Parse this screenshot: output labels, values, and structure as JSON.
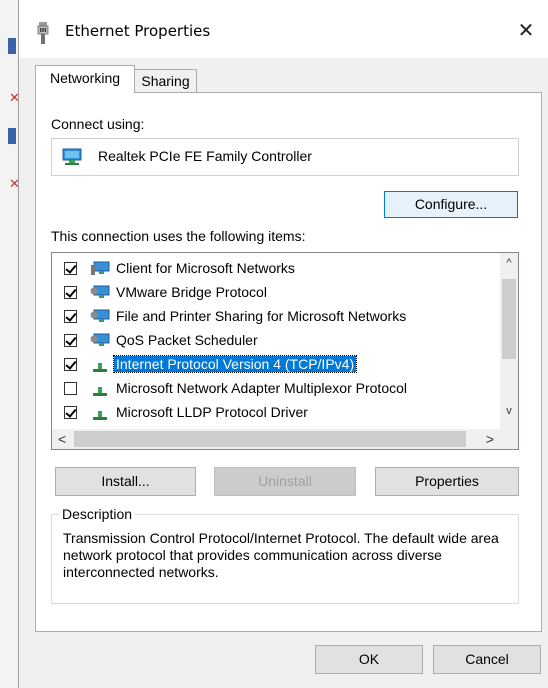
{
  "window": {
    "title": "Ethernet Properties",
    "close_glyph": "✕"
  },
  "tabs": [
    {
      "label": "Networking",
      "active": true
    },
    {
      "label": "Sharing",
      "active": false
    }
  ],
  "connect": {
    "label": "Connect using:",
    "adapter_name": "Realtek PCIe FE Family Controller",
    "adapter_icon": "network-adapter-icon",
    "configure_label": "Configure..."
  },
  "items_section": {
    "label": "This connection uses the following items:",
    "items": [
      {
        "label": "Client for Microsoft Networks",
        "checked": true,
        "icon": "network-client-icon",
        "selected": false
      },
      {
        "label": "VMware Bridge Protocol",
        "checked": true,
        "icon": "network-service-icon",
        "selected": false
      },
      {
        "label": "File and Printer Sharing for Microsoft Networks",
        "checked": true,
        "icon": "network-service-icon",
        "selected": false
      },
      {
        "label": "QoS Packet Scheduler",
        "checked": true,
        "icon": "network-service-icon",
        "selected": false
      },
      {
        "label": "Internet Protocol Version 4 (TCP/IPv4)",
        "checked": true,
        "icon": "protocol-icon",
        "selected": true
      },
      {
        "label": "Microsoft Network Adapter Multiplexor Protocol",
        "checked": false,
        "icon": "protocol-icon",
        "selected": false
      },
      {
        "label": "Microsoft LLDP Protocol Driver",
        "checked": true,
        "icon": "protocol-icon",
        "selected": false
      }
    ],
    "scroll_up": "^",
    "scroll_down": "v",
    "scroll_left": "<",
    "scroll_right": ">"
  },
  "buttons": {
    "install": "Install...",
    "uninstall": "Uninstall",
    "properties": "Properties",
    "ok": "OK",
    "cancel": "Cancel"
  },
  "description": {
    "legend": "Description",
    "text": "Transmission Control Protocol/Internet Protocol. The default wide area network protocol that provides communication across diverse interconnected networks."
  },
  "colors": {
    "selection": "#0078d7",
    "dialog_bg": "#f0f0f0",
    "panel_bg": "#ffffff"
  }
}
